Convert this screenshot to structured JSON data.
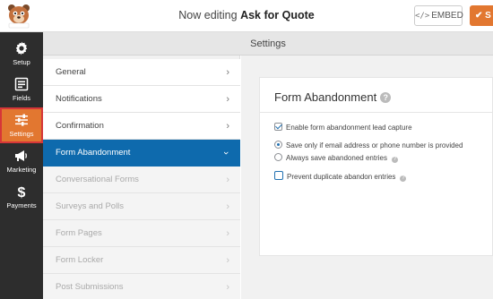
{
  "header": {
    "title_prefix": "Now editing",
    "form_name": "Ask for Quote",
    "embed_label": "EMBED",
    "embed_icon": "</>",
    "save_label": "S",
    "save_icon": "✔"
  },
  "rail": {
    "items": [
      {
        "label": "Setup",
        "icon": "gear-icon"
      },
      {
        "label": "Fields",
        "icon": "fields-icon"
      },
      {
        "label": "Settings",
        "icon": "sliders-icon",
        "active": true
      },
      {
        "label": "Marketing",
        "icon": "megaphone-icon"
      },
      {
        "label": "Payments",
        "icon": "dollar-icon"
      }
    ]
  },
  "settings_header": {
    "title": "Settings"
  },
  "menu": {
    "items": [
      {
        "label": "General",
        "state": "normal"
      },
      {
        "label": "Notifications",
        "state": "normal"
      },
      {
        "label": "Confirmation",
        "state": "normal"
      },
      {
        "label": "Form Abandonment",
        "state": "active"
      },
      {
        "label": "Conversational Forms",
        "state": "disabled"
      },
      {
        "label": "Surveys and Polls",
        "state": "disabled"
      },
      {
        "label": "Form Pages",
        "state": "disabled"
      },
      {
        "label": "Form Locker",
        "state": "disabled"
      },
      {
        "label": "Post Submissions",
        "state": "disabled"
      }
    ],
    "chevron": "›"
  },
  "panel": {
    "title": "Form Abandonment",
    "help": "?",
    "enable_label": "Enable form abandonment lead capture",
    "enable_checked": true,
    "radio_options": [
      {
        "label": "Save only if email address or phone number is provided",
        "checked": true
      },
      {
        "label": "Always save abandoned entries",
        "checked": false
      }
    ],
    "prevent_label": "Prevent duplicate abandon entries",
    "prevent_checked": false
  },
  "colors": {
    "accent_orange": "#e27730",
    "active_blue": "#0e6aad",
    "rail_bg": "#2d2d2d",
    "highlight_red": "#d63638"
  }
}
